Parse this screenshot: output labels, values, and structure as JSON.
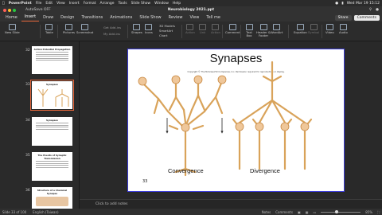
{
  "macbar": {
    "app": "PowerPoint",
    "menus": [
      "File",
      "Edit",
      "View",
      "Insert",
      "Format",
      "Arrange",
      "Tools",
      "Slide Show",
      "Window",
      "Help"
    ],
    "datetime": "Wed Mar 19 15:12"
  },
  "window": {
    "title": "Neurobiology 2021.ppt",
    "autosave_label": "AutoSave",
    "autosave_state": "OFF"
  },
  "ribbon_tabs": [
    "Home",
    "Insert",
    "Draw",
    "Design",
    "Transitions",
    "Animations",
    "Slide Show",
    "Review",
    "View",
    "Tell me"
  ],
  "active_tab": "Insert",
  "share_label": "Share",
  "comments_label": "Comments",
  "ribbon": {
    "new_slide": "New Slide",
    "table": "Table",
    "pictures": "Pictures",
    "screenshot": "Screenshot",
    "add_ins_1": "Get Add-ins",
    "add_ins_2": "My Add-ins",
    "shapes": "Shapes",
    "icons": "Icons",
    "models": "3D Models",
    "smartart": "SmartArt",
    "chart": "Chart",
    "action": "Action",
    "link": "Link",
    "action2": "Action",
    "comment": "Comment",
    "textbox": "Text Box",
    "header_footer": "Header & Footer",
    "wordart": "WordArt",
    "equation": "Equation",
    "symbol": "Symbol",
    "video": "Video",
    "audio": "Audio"
  },
  "thumbnails": [
    {
      "num": "32",
      "title": "Action Potential Propagation",
      "lines": 5
    },
    {
      "num": "33",
      "title": "Synapses",
      "lines": 0
    },
    {
      "num": "34",
      "title": "Synapses",
      "lines": 4
    },
    {
      "num": "35",
      "title": "The Events of Synaptic Transmission",
      "lines": 4
    },
    {
      "num": "36",
      "title": "Structure of a Chemical Synapse",
      "lines": 3
    }
  ],
  "slide": {
    "title": "Synapses",
    "copyright": "Copyright © The McGraw-Hill Companies, Inc. Permission required for reproduction or display.",
    "caption_left": "Convergence",
    "caption_right": "Divergence",
    "number": "33"
  },
  "notes_placeholder": "Click to add notes",
  "status": {
    "slide_info": "Slide 33 of 100",
    "language": "English (Taiwan)",
    "notes_btn": "Notes",
    "comments_btn": "Comments",
    "zoom": "85%"
  }
}
